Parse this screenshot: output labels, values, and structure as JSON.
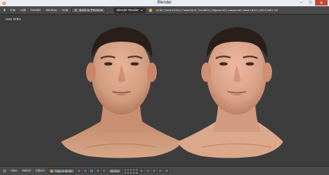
{
  "window": {
    "title": "Blender",
    "controls": [
      "–",
      "□",
      "✕"
    ]
  },
  "header": {
    "menus": [
      "File",
      "Add",
      "Render",
      "Window",
      "Help"
    ],
    "back_button": "Back to Previous",
    "render_engine": "Blender Render",
    "stats": "v2.69 | Verts:21316 | Faces:58 8 | Tris:5824 | Objects:0/2 | Lamps:0/0 | Mem:18.0.0 | MV:0.MB | 0/2"
  },
  "viewport": {
    "label": "User Ortho",
    "background": "#3d3d3d",
    "skin_color": "#d9a283",
    "hair_color": "#2a1f18"
  },
  "footer": {
    "view": "View",
    "select": "Select",
    "object": "Object",
    "mode": "Object Mode",
    "pivot": "Global",
    "selector_icons": [
      "viewport-shading-icon",
      "pivot-icon",
      "manipulator-icon"
    ]
  },
  "icons": {
    "blender_logo": "blender-logo-icon",
    "info_editor": "info-editor-icon"
  }
}
